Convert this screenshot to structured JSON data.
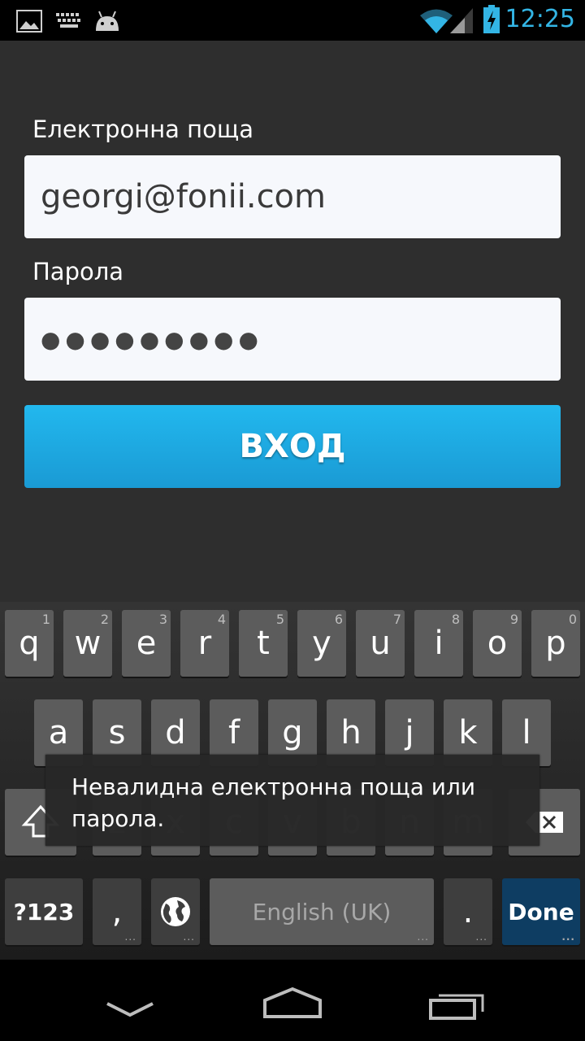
{
  "status_bar": {
    "time": "12:25",
    "icons": [
      "image-notification-icon",
      "keyboard-icon",
      "android-icon",
      "wifi-icon",
      "signal-icon",
      "battery-charging-icon"
    ],
    "accent": "#33b5e5"
  },
  "form": {
    "email_label": "Електронна поща",
    "email_value": "georgi@fonii.com",
    "password_label": "Парола",
    "password_value": "●●●●●●●●●",
    "login_label": "ВХОД",
    "button_color": "#1fb0e8"
  },
  "keyboard": {
    "row1": [
      {
        "letter": "q",
        "hint": "1"
      },
      {
        "letter": "w",
        "hint": "2"
      },
      {
        "letter": "e",
        "hint": "3"
      },
      {
        "letter": "r",
        "hint": "4"
      },
      {
        "letter": "t",
        "hint": "5"
      },
      {
        "letter": "y",
        "hint": "6"
      },
      {
        "letter": "u",
        "hint": "7"
      },
      {
        "letter": "i",
        "hint": "8"
      },
      {
        "letter": "o",
        "hint": "9"
      },
      {
        "letter": "p",
        "hint": "0"
      }
    ],
    "row2": [
      "a",
      "s",
      "d",
      "f",
      "g",
      "h",
      "j",
      "k",
      "l"
    ],
    "row3": [
      "z",
      "x",
      "c",
      "v",
      "b",
      "n",
      "m"
    ],
    "symbols_label": "?123",
    "comma_label": ",",
    "space_label": "English (UK)",
    "period_label": ".",
    "done_label": "Done",
    "long_press_hint": "..."
  },
  "toast": {
    "message": "Невалидна електронна поща или парола."
  },
  "nav_bar": {
    "icons": [
      "back-icon",
      "home-icon",
      "recent-apps-icon"
    ]
  }
}
